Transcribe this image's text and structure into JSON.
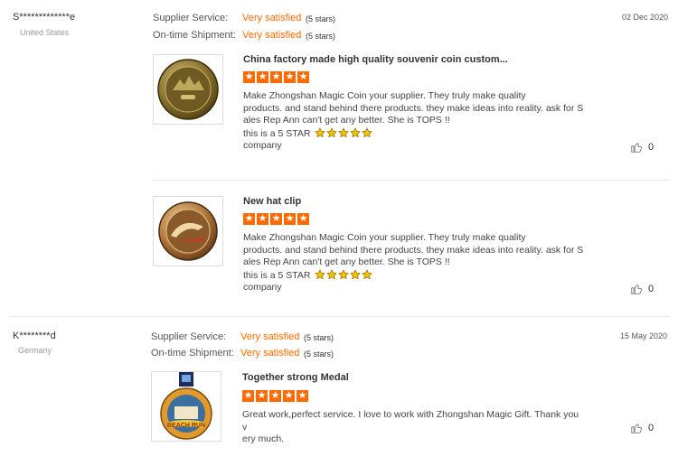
{
  "reviews": [
    {
      "buyer": {
        "name": "S*************e",
        "country": "United States"
      },
      "supplier_service_label": "Supplier Service:",
      "supplier_service_value": "Very satisfied",
      "supplier_service_stars": "(5 stars)",
      "shipment_label": "On-time Shipment:",
      "shipment_value": "Very satisfied",
      "shipment_stars": "(5 stars)",
      "date": "02 Dec 2020",
      "products": [
        {
          "title": "China factory made high quality souvenir coin custom...",
          "body_lines": [
            "Make Zhongshan Magic Coin your supplier. They truly make quality",
            "products. and stand behind there products. they make ideas into reality. ask for S",
            "ales Rep Ann can't get any better. She is TOPS !!"
          ],
          "star_line_prefix": "this is a  5   STAR",
          "last_line": "company",
          "likes": "0"
        },
        {
          "title": "New hat clip",
          "body_lines": [
            "Make Zhongshan Magic Coin your supplier. They truly make quality",
            "products. and stand behind there products. they make ideas into reality. ask for S",
            "ales Rep Ann can't get any better. She is TOPS !!"
          ],
          "star_line_prefix": "this is a  5   STAR",
          "last_line": "company",
          "likes": "0"
        }
      ]
    },
    {
      "buyer": {
        "name": "K********d",
        "country": "Germany"
      },
      "supplier_service_label": "Supplier Service:",
      "supplier_service_value": "Very satisfied",
      "supplier_service_stars": "(5 stars)",
      "shipment_label": "On-time Shipment:",
      "shipment_value": "Very satisfied",
      "shipment_stars": "(5 stars)",
      "date": "15 May 2020",
      "products": [
        {
          "title": "Together strong Medal",
          "body_lines": [
            "Great work,perfect service. I love to work with Zhongshan Magic Gift. Thank you v",
            "ery much."
          ],
          "likes": "0",
          "medal_text": "BEACH RUN"
        }
      ]
    }
  ],
  "rating_star_glyph": "★",
  "colors": {
    "accent": "#ff6a00",
    "divider": "#e6e6e6",
    "gold_star": "#f5b800"
  }
}
